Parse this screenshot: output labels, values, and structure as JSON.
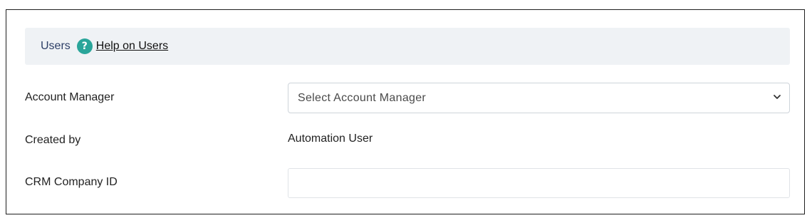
{
  "section": {
    "title": "Users",
    "help_icon": "question-circle-icon",
    "help_link": "Help on Users"
  },
  "fields": {
    "account_manager": {
      "label": "Account Manager",
      "placeholder": "Select Account Manager"
    },
    "created_by": {
      "label": "Created by",
      "value": "Automation User"
    },
    "crm_company_id": {
      "label": "CRM Company ID",
      "value": ""
    }
  },
  "colors": {
    "accent": "#2aa59a",
    "header_bg": "#eff2f5",
    "title_text": "#2c3e66"
  }
}
